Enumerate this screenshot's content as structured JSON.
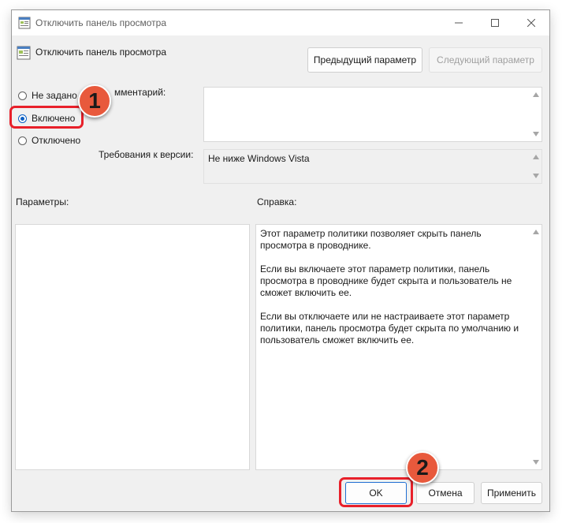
{
  "window": {
    "title": "Отключить панель просмотра",
    "subtitle": "Отключить панель просмотра"
  },
  "nav": {
    "prev_label": "Предыдущий параметр",
    "next_label": "Следующий параметр"
  },
  "state": {
    "options": [
      {
        "label": "Не задано",
        "checked": false
      },
      {
        "label": "Включено",
        "checked": true
      },
      {
        "label": "Отключено",
        "checked": false
      }
    ]
  },
  "comment": {
    "label": "мментарий:",
    "value": ""
  },
  "requirements": {
    "label": "Требования к версии:",
    "value": "Не ниже Windows Vista"
  },
  "sections": {
    "params_label": "Параметры:",
    "help_label": "Справка:"
  },
  "help": {
    "paragraphs": [
      "Этот параметр политики позволяет скрыть панель просмотра в проводнике.",
      "Если вы включаете этот параметр политики, панель просмотра в проводнике будет скрыта и пользователь не сможет включить ее.",
      "Если вы отключаете или не настраиваете этот параметр политики, панель просмотра будет скрыта по умолчанию и пользователь сможет включить ее."
    ]
  },
  "footer": {
    "ok_label": "OK",
    "cancel_label": "Отмена",
    "apply_label": "Применить"
  },
  "annotations": {
    "badge1": "1",
    "badge2": "2",
    "color": "#e8202a",
    "badge_color": "#e8593c"
  },
  "colors": {
    "accent": "#0a5fc4",
    "window_bg": "#f0f0f0"
  }
}
